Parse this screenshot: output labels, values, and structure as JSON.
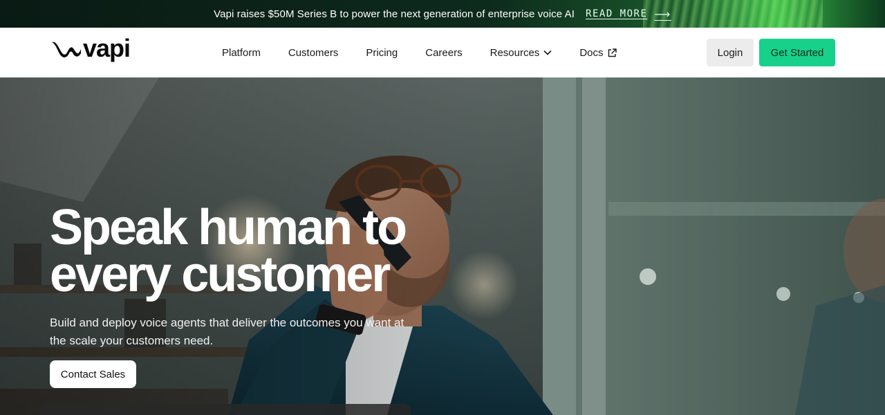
{
  "banner": {
    "text": "Vapi raises $50M Series B to power the next generation of enterprise voice AI",
    "link_label": "READ MORE",
    "arrow": "⟶"
  },
  "header": {
    "logo_text": "vapi",
    "logo_icon": "vapi-wave-logo",
    "nav": [
      {
        "label": "Platform"
      },
      {
        "label": "Customers"
      },
      {
        "label": "Pricing"
      },
      {
        "label": "Careers"
      },
      {
        "label": "Resources",
        "icon": "chevron-down-icon"
      },
      {
        "label": "Docs",
        "icon": "external-link-icon"
      }
    ],
    "login_label": "Login",
    "get_started_label": "Get Started"
  },
  "hero": {
    "title_line1": "Speak human to",
    "title_line2": "every customer",
    "subtitle": "Build and deploy voice agents that deliver the outcomes you want at the scale your customers need.",
    "contact_label": "Contact Sales",
    "background_image": "man-on-phone-office-photo"
  },
  "colors": {
    "accent_green": "#17d18b",
    "header_bg": "#ffffff",
    "login_bg": "#ececec"
  }
}
